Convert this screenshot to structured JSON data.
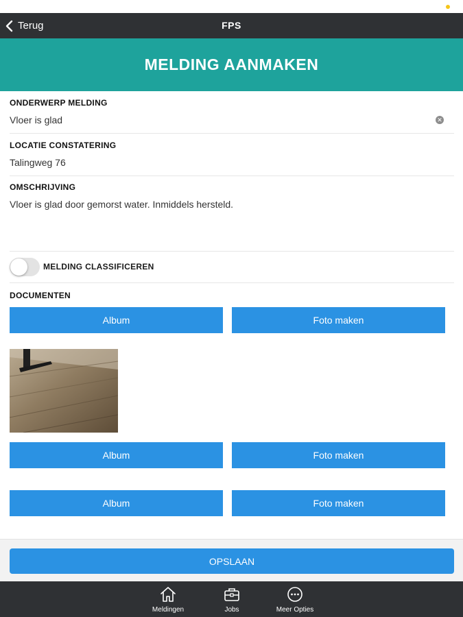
{
  "nav": {
    "back_label": "Terug",
    "title": "FPS"
  },
  "page": {
    "heading": "MELDING AANMAKEN"
  },
  "form": {
    "subject": {
      "label": "ONDERWERP MELDING",
      "value": "Vloer is glad"
    },
    "location": {
      "label": "LOCATIE CONSTATERING",
      "value": "Talingweg 76"
    },
    "description": {
      "label": "OMSCHRIJVING",
      "value": "Vloer is glad door gemorst water. Inmiddels hersteld."
    },
    "classify": {
      "label": "MELDING CLASSIFICEREN",
      "enabled": false
    }
  },
  "documents": {
    "label": "DOCUMENTEN",
    "rows": [
      {
        "album": "Album",
        "photo": "Foto maken"
      },
      {
        "album": "Album",
        "photo": "Foto maken"
      },
      {
        "album": "Album",
        "photo": "Foto maken"
      }
    ]
  },
  "actions": {
    "save_label": "OPSLAAN"
  },
  "tabbar": {
    "items": [
      {
        "label": "Meldingen",
        "icon": "home-icon"
      },
      {
        "label": "Jobs",
        "icon": "briefcase-icon"
      },
      {
        "label": "Meer Opties",
        "icon": "more-icon"
      }
    ]
  },
  "colors": {
    "nav": "#2f3134",
    "accent": "#1ea39c",
    "button": "#2b92e3"
  }
}
